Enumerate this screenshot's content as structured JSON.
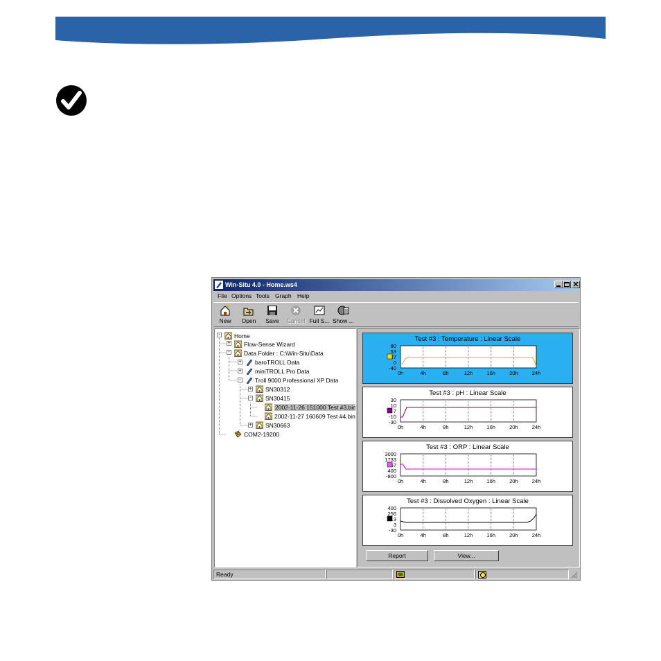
{
  "colors": {
    "banner": "#2a63a8",
    "selected_graph_bg": "#2ab0f0",
    "titlebar_start": "#0a246a"
  },
  "window": {
    "title": "Win-Situ 4.0 - Home.ws4",
    "menus": [
      "File",
      "Options",
      "Tools",
      "Graph",
      "Help"
    ],
    "toolbar": [
      {
        "label": "New",
        "icon": "new-icon",
        "enabled": true
      },
      {
        "label": "Open",
        "icon": "open-icon",
        "enabled": true
      },
      {
        "label": "Save",
        "icon": "save-icon",
        "enabled": true
      },
      {
        "label": "Cancel",
        "icon": "cancel-icon",
        "enabled": false
      },
      {
        "label": "Full S...",
        "icon": "full-screen-icon",
        "enabled": true
      },
      {
        "label": "Show ...",
        "icon": "show-icon",
        "enabled": true
      }
    ]
  },
  "tree": [
    {
      "label": "Home",
      "icon": "home-folder-icon",
      "depth": 0,
      "expander": "-"
    },
    {
      "label": "Flow-Sense Wizard",
      "icon": "wizard-icon",
      "depth": 1,
      "expander": "+"
    },
    {
      "label": "Data Folder : C:\\Win-Situ\\Data",
      "icon": "data-folder-icon",
      "depth": 1,
      "expander": "-"
    },
    {
      "label": "baroTROLL Data",
      "icon": "probe-icon",
      "depth": 2,
      "expander": "+"
    },
    {
      "label": "miniTROLL Pro Data",
      "icon": "probe-icon",
      "depth": 2,
      "expander": "+"
    },
    {
      "label": "Troll 9000 Professional XP Data",
      "icon": "probe-icon",
      "depth": 2,
      "expander": "-"
    },
    {
      "label": "SN30312",
      "icon": "serial-folder-icon",
      "depth": 3,
      "expander": "+"
    },
    {
      "label": "SN30415",
      "icon": "serial-folder-icon",
      "depth": 3,
      "expander": "-"
    },
    {
      "label": "2002-11-26 151000 Test #3.bin",
      "icon": "data-file-icon",
      "depth": 4,
      "expander": "",
      "selected": true
    },
    {
      "label": "2002-11-27 160609 Test #4.bin",
      "icon": "data-file-icon",
      "depth": 4,
      "expander": ""
    },
    {
      "label": "SN30663",
      "icon": "serial-folder-icon",
      "depth": 3,
      "expander": "+"
    },
    {
      "label": "COM2-19200",
      "icon": "com-port-icon",
      "depth": 1,
      "expander": ""
    }
  ],
  "graphs": [
    {
      "title": "Test #3 : Temperature : Linear Scale",
      "ticks": [
        "80",
        "53",
        "27",
        "0",
        "-40"
      ],
      "xticks": [
        "0h",
        "4h",
        "8h",
        "12h",
        "16h",
        "20h",
        "24h"
      ],
      "color": "#e0b000",
      "selected": true,
      "legend_color": "#f0e000"
    },
    {
      "title": "Test #3 : pH : Linear Scale",
      "ticks": [
        "30",
        "10",
        "7",
        "-10",
        "-30"
      ],
      "xticks": [
        "0h",
        "4h",
        "8h",
        "12h",
        "16h",
        "20h",
        "24h"
      ],
      "color": "#800080",
      "selected": false,
      "legend_color": "#800080"
    },
    {
      "title": "Test #3 : ORP : Linear Scale",
      "ticks": [
        "3000",
        "1733",
        "467",
        "400",
        "-800"
      ],
      "xticks": [
        "0h",
        "4h",
        "8h",
        "12h",
        "16h",
        "20h",
        "24h"
      ],
      "color": "#e000e0",
      "selected": false,
      "legend_color": "#e060e0"
    },
    {
      "title": "Test #3 : Dissolved Oxygen : Linear Scale",
      "ticks": [
        "400",
        "256",
        "113",
        "3",
        "-30"
      ],
      "xticks": [
        "0h",
        "4h",
        "8h",
        "12h",
        "16h",
        "20h",
        "24h"
      ],
      "color": "#000000",
      "selected": false,
      "legend_color": "#000000"
    }
  ],
  "buttons": {
    "report": "Report",
    "view": "View..."
  },
  "status": {
    "text": "Ready"
  }
}
